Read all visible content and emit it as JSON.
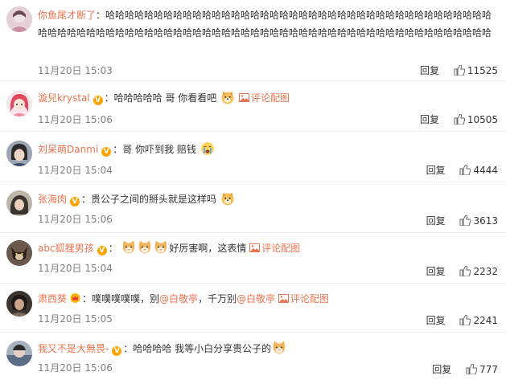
{
  "comments": [
    {
      "username": "你鱼尾才断了",
      "text": "哈哈哈哈哈哈哈哈哈哈哈哈哈哈哈哈哈哈哈哈哈哈哈哈哈哈哈哈哈哈哈哈哈哈哈哈哈哈哈哈哈哈哈哈哈哈哈哈哈哈哈哈哈哈哈哈哈哈哈哈哈哈哈哈哈哈哈哈哈哈哈哈哈哈哈哈哈哈哈哈哈哈哈哈哈哈哈",
      "time": "11月20日 15:03",
      "reply": "回复",
      "likes": "11525"
    },
    {
      "username": "漩兒krystal",
      "text": "哈哈哈哈哈 哥 你看看吧",
      "pic_link": "评论配图",
      "time": "11月20日 15:06",
      "reply": "回复",
      "likes": "10505"
    },
    {
      "username": "刘呆萌Danmi",
      "text": "哥 你吓到我 赔钱",
      "time": "11月20日 15:04",
      "reply": "回复",
      "likes": "4444"
    },
    {
      "username": "张海肉",
      "text": "贵公子之间的掰头就是这样吗",
      "time": "11月20日 15:06",
      "reply": "回复",
      "likes": "3613"
    },
    {
      "username": "abc狐狸男孩",
      "text": "好厉害啊，这表情",
      "pic_link": "评论配图",
      "time": "11月20日 15:04",
      "reply": "回复",
      "likes": "2232"
    },
    {
      "username": "肃西葵",
      "text_a": "噗噗噗噗噗，别",
      "mention_a": "@白敬亭",
      "text_b": "，千万别",
      "mention_b": "@白敬亭",
      "pic_link": "评论配图",
      "time": "11月20日 15:05",
      "reply": "回复",
      "likes": "2241"
    },
    {
      "username": "我又不是大無畏-",
      "text": "哈哈哈哈 我等小白分享贵公子的",
      "time": "11月20日 15:06",
      "reply": "回复",
      "likes": "777"
    }
  ],
  "colon": "：",
  "v_badge": "V",
  "icons": {
    "thumb": "thumbs-up-icon",
    "verified": "verified-v-icon",
    "crown": "crown-icon",
    "pic": "image-icon",
    "emoji_doge": "doge-emoji-icon",
    "emoji_cry": "crying-emoji-icon",
    "emoji_cat": "cat-emoji-icon"
  },
  "colors": {
    "username": "#eb7350",
    "link": "#eb7350",
    "text": "#333333",
    "meta": "#808080",
    "verified": "#ffa300",
    "separator": "#eeeeee"
  }
}
